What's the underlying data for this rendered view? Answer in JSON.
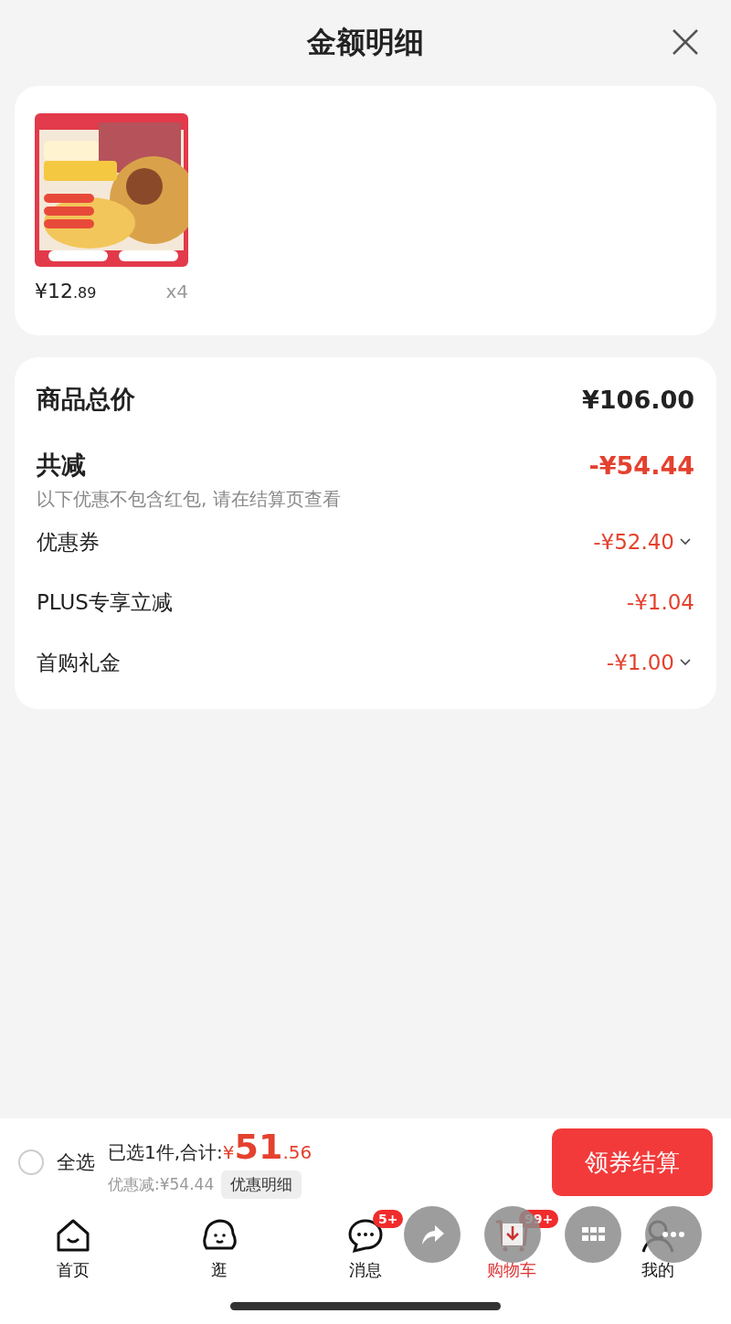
{
  "header": {
    "title": "金额明细"
  },
  "product": {
    "price_main": "¥12",
    "price_cents": ".89",
    "quantity": "x4"
  },
  "summary": {
    "total_label": "商品总价",
    "total": "¥106.00",
    "discount_label": "共减",
    "discount": "-¥54.44",
    "note": "以下优惠不包含红包, 请在结算页查看",
    "items": [
      {
        "label": "优惠券",
        "amount": "-¥52.40",
        "expandable": true
      },
      {
        "label": "PLUS专享立减",
        "amount": "-¥1.04",
        "expandable": false
      },
      {
        "label": "首购礼金",
        "amount": "-¥1.00",
        "expandable": true
      }
    ]
  },
  "checkout_bar": {
    "select_all": {
      "label": "全选",
      "checked": false
    },
    "selected_text": "已选1件,合计:",
    "currency": "¥",
    "total_main": "51",
    "total_cents": ".56",
    "saved": "优惠减:¥54.44",
    "detail_button": "优惠明细",
    "checkout_button": "领券结算"
  },
  "tabs": [
    {
      "label": "首页",
      "kind": "home",
      "selected": false
    },
    {
      "label": "逛",
      "kind": "blob",
      "selected": false
    },
    {
      "label": "消息",
      "kind": "chat",
      "selected": false,
      "badge": "5+"
    },
    {
      "label": "购物车",
      "kind": "cart",
      "selected": true,
      "badge": "99+"
    },
    {
      "label": "我的",
      "kind": "person",
      "selected": false
    }
  ],
  "floating_buttons": [
    {
      "kind": "share"
    },
    {
      "kind": "download"
    },
    {
      "kind": "grid"
    },
    {
      "kind": "more"
    }
  ]
}
